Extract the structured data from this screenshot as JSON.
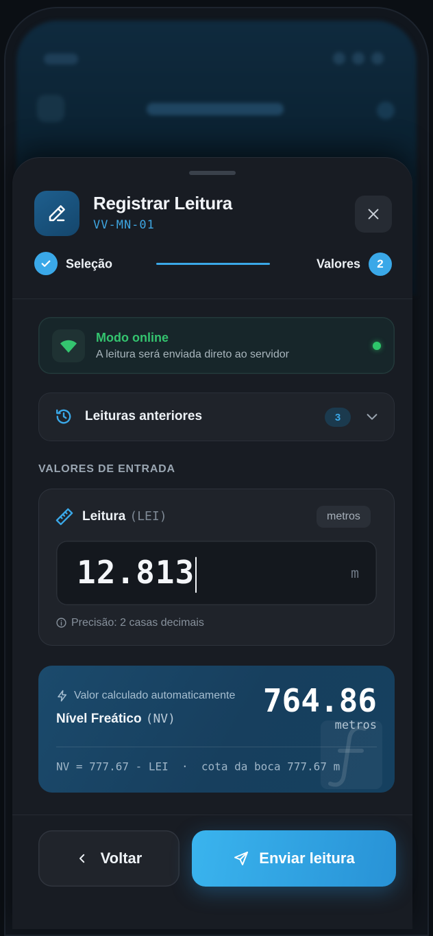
{
  "header": {
    "title": "Registrar Leitura",
    "subtitle": "VV-MN-01",
    "icon": "pencil-icon",
    "close_icon": "close-icon"
  },
  "stepper": {
    "step1_label": "Seleção",
    "step2_label": "Valores",
    "step2_number": "2"
  },
  "status": {
    "title": "Modo online",
    "subtitle": "A leitura será enviada direto ao servidor",
    "icon": "wifi-icon",
    "color": "#34c46f"
  },
  "previous": {
    "label": "Leituras anteriores",
    "count": "3",
    "icon": "history-icon"
  },
  "inputs_section": {
    "title": "VALORES DE ENTRADA"
  },
  "reading": {
    "label": "Leitura",
    "code": "(LEI)",
    "unit_chip": "metros",
    "value": "12.813",
    "unit_suffix": "m",
    "hint": "Precisão: 2 casas decimais"
  },
  "calculated": {
    "caption": "Valor calculado automaticamente",
    "label": "Nível Freático",
    "code": "(NV)",
    "value": "764.86",
    "unit": "metros",
    "formula": "NV = 777.67 - LEI  ·  cota da boca 777.67 m"
  },
  "actions": {
    "back_label": "Voltar",
    "send_label": "Enviar leitura"
  },
  "colors": {
    "accent": "#3aa8e8",
    "background": "#181c23"
  }
}
